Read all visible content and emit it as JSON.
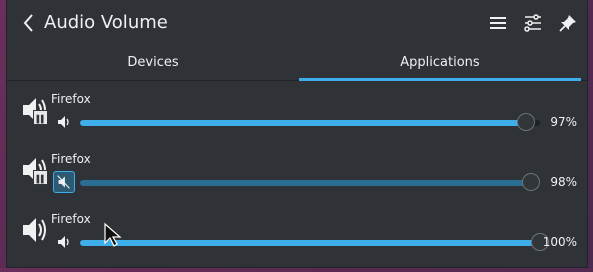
{
  "header": {
    "title": "Audio Volume",
    "icons": [
      "back-icon",
      "hamburger-menu-icon",
      "mixer-settings-icon",
      "pin-icon"
    ]
  },
  "tabs": [
    {
      "label": "Devices",
      "active": false
    },
    {
      "label": "Applications",
      "active": true
    }
  ],
  "streams": [
    {
      "name": "Firefox",
      "volume_percent": 97,
      "percent_label": "97%",
      "paused": true,
      "muted": false
    },
    {
      "name": "Firefox",
      "volume_percent": 98,
      "percent_label": "98%",
      "paused": true,
      "muted": true
    },
    {
      "name": "Firefox",
      "volume_percent": 100,
      "percent_label": "100%",
      "paused": false,
      "muted": false
    }
  ],
  "colors": {
    "accent": "#3daee9",
    "panel_bg": "#2f3337",
    "text": "#eff0f1"
  }
}
